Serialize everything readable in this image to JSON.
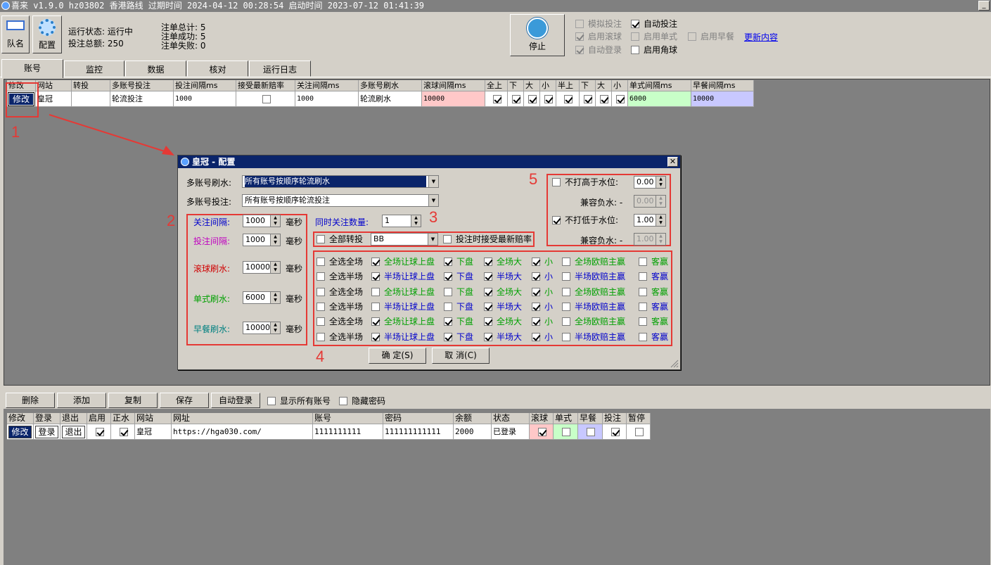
{
  "window": {
    "title": "喜来 v1.9.0 hz03802 香港路线 过期时间 2024-04-12 00:28:54 启动时间 2023-07-12 01:41:39",
    "min_label": "_"
  },
  "top": {
    "btn_team": "队名",
    "btn_config": "配置",
    "status_label": "运行状态: 运行中",
    "total_label": "投注总额: 250",
    "orders_total": "注单总计: 5",
    "orders_ok": "注单成功: 5",
    "orders_fail": "注单失败: 0",
    "stop_label": "停止",
    "options": [
      {
        "label": "模拟投注",
        "checked": false,
        "disabled": true
      },
      {
        "label": "自动投注",
        "checked": true,
        "disabled": false
      },
      {
        "label": "启用滚球",
        "checked": true,
        "disabled": true
      },
      {
        "label": "启用单式",
        "checked": false,
        "disabled": true
      },
      {
        "label": "启用早餐",
        "checked": false,
        "disabled": true
      },
      {
        "label": "自动登录",
        "checked": true,
        "disabled": true
      },
      {
        "label": "启用角球",
        "checked": false,
        "disabled": false
      }
    ],
    "update_link": "更新内容"
  },
  "tabs": [
    "账号",
    "监控",
    "数据",
    "核对",
    "运行日志"
  ],
  "grid1": {
    "headers": [
      "修改",
      "网站",
      "转投",
      "多账号投注",
      "投注间隔ms",
      "接受最新赔率",
      "关注间隔ms",
      "多账号刷水",
      "滚球间隔ms",
      "全上",
      "下",
      "大",
      "小",
      "半上",
      "下",
      "大",
      "小",
      "单式间隔ms",
      "早餐间隔ms"
    ],
    "row": {
      "edit": "修改",
      "site": "皇冠",
      "transfer": "",
      "multi_bet": "轮流投注",
      "bet_interval": "1000",
      "watch_interval": "1000",
      "multi_refresh": "轮流刷水",
      "live_interval": "10000",
      "single_interval": "6000",
      "early_interval": "10000"
    },
    "row_checks": [
      true,
      true,
      true,
      true,
      true,
      true,
      true,
      true
    ]
  },
  "annotations": [
    "1",
    "2",
    "3",
    "4",
    "5"
  ],
  "dialog": {
    "title": "皇冠 - 配置",
    "multi_refresh_label": "多账号刷水:",
    "multi_refresh_value": "所有账号按顺序轮流刷水",
    "multi_bet_label": "多账号投注:",
    "multi_bet_value": "所有账号按顺序轮流投注",
    "intervals": [
      {
        "label": "关注间隔:",
        "value": "1000",
        "unit": "毫秒",
        "color": "#0000cc"
      },
      {
        "label": "投注间隔:",
        "value": "1000",
        "unit": "毫秒",
        "color": "#c000c0"
      },
      {
        "label": "滚球刷水:",
        "value": "10000",
        "unit": "毫秒",
        "color": "#d00000"
      },
      {
        "label": "单式刷水:",
        "value": "6000",
        "unit": "毫秒",
        "color": "#00a000"
      },
      {
        "label": "早餐刷水:",
        "value": "10000",
        "unit": "毫秒",
        "color": "#008080"
      }
    ],
    "concurrent_label": "同时关注数量:",
    "concurrent_value": "1",
    "transfer_all_label": "全部转投",
    "transfer_value": "BB",
    "accept_odds_label": "投注时接受最新赔率",
    "water": [
      {
        "label": "不打高于水位:",
        "value": "0.00",
        "checked": false
      },
      {
        "label": "兼容负水: -",
        "value": "0.00"
      },
      {
        "label": "不打低于水位:",
        "value": "1.00",
        "checked": true
      },
      {
        "label": "兼容负水: -",
        "value": "1.00"
      }
    ],
    "matrix": [
      [
        {
          "t": "全选全场",
          "c": false,
          "k": "#000"
        },
        {
          "t": "全场让球上盘",
          "c": true,
          "k": "#00a000"
        },
        {
          "t": "下盘",
          "c": true,
          "k": "#00a000"
        },
        {
          "t": "全场大",
          "c": true,
          "k": "#00a000"
        },
        {
          "t": "小",
          "c": true,
          "k": "#00a000"
        },
        {
          "t": "全场欧赔主赢",
          "c": false,
          "k": "#00a000"
        },
        {
          "t": "客赢",
          "c": false,
          "k": "#00a000"
        }
      ],
      [
        {
          "t": "全选半场",
          "c": false,
          "k": "#000"
        },
        {
          "t": "半场让球上盘",
          "c": true,
          "k": "#0000cc"
        },
        {
          "t": "下盘",
          "c": true,
          "k": "#0000cc"
        },
        {
          "t": "半场大",
          "c": true,
          "k": "#0000cc"
        },
        {
          "t": "小",
          "c": true,
          "k": "#0000cc"
        },
        {
          "t": "半场欧赔主赢",
          "c": false,
          "k": "#0000cc"
        },
        {
          "t": "客赢",
          "c": false,
          "k": "#0000cc"
        }
      ],
      [
        {
          "t": "全选全场",
          "c": false,
          "k": "#000"
        },
        {
          "t": "全场让球上盘",
          "c": false,
          "k": "#00a000"
        },
        {
          "t": "下盘",
          "c": false,
          "k": "#00a000"
        },
        {
          "t": "全场大",
          "c": true,
          "k": "#00a000"
        },
        {
          "t": "小",
          "c": true,
          "k": "#00a000"
        },
        {
          "t": "全场欧赔主赢",
          "c": false,
          "k": "#00a000"
        },
        {
          "t": "客赢",
          "c": false,
          "k": "#00a000"
        }
      ],
      [
        {
          "t": "全选半场",
          "c": false,
          "k": "#000"
        },
        {
          "t": "半场让球上盘",
          "c": false,
          "k": "#0000cc"
        },
        {
          "t": "下盘",
          "c": false,
          "k": "#0000cc"
        },
        {
          "t": "半场大",
          "c": true,
          "k": "#0000cc"
        },
        {
          "t": "小",
          "c": true,
          "k": "#0000cc"
        },
        {
          "t": "半场欧赔主赢",
          "c": false,
          "k": "#0000cc"
        },
        {
          "t": "客赢",
          "c": false,
          "k": "#0000cc"
        }
      ],
      [
        {
          "t": "全选全场",
          "c": false,
          "k": "#000"
        },
        {
          "t": "全场让球上盘",
          "c": true,
          "k": "#00a000"
        },
        {
          "t": "下盘",
          "c": true,
          "k": "#00a000"
        },
        {
          "t": "全场大",
          "c": true,
          "k": "#00a000"
        },
        {
          "t": "小",
          "c": true,
          "k": "#00a000"
        },
        {
          "t": "全场欧赔主赢",
          "c": false,
          "k": "#00a000"
        },
        {
          "t": "客赢",
          "c": false,
          "k": "#00a000"
        }
      ],
      [
        {
          "t": "全选半场",
          "c": false,
          "k": "#000"
        },
        {
          "t": "半场让球上盘",
          "c": true,
          "k": "#0000cc"
        },
        {
          "t": "下盘",
          "c": true,
          "k": "#0000cc"
        },
        {
          "t": "半场大",
          "c": true,
          "k": "#0000cc"
        },
        {
          "t": "小",
          "c": true,
          "k": "#0000cc"
        },
        {
          "t": "半场欧赔主赢",
          "c": false,
          "k": "#0000cc"
        },
        {
          "t": "客赢",
          "c": false,
          "k": "#0000cc"
        }
      ]
    ],
    "ok_label": "确 定(S)",
    "cancel_label": "取 消(C)"
  },
  "toolbar2": {
    "delete": "删除",
    "add": "添加",
    "copy": "复制",
    "save": "保存",
    "auto_login": "自动登录",
    "show_all": "显示所有账号",
    "hide_pwd": "隐藏密码"
  },
  "grid2": {
    "headers": [
      "修改",
      "登录",
      "退出",
      "启用",
      "正水",
      "网站",
      "网址",
      "账号",
      "密码",
      "余额",
      "状态",
      "滚球",
      "单式",
      "早餐",
      "投注",
      "暂停"
    ],
    "row": {
      "edit": "修改",
      "login": "登录",
      "logout": "退出",
      "site": "皇冠",
      "url": "https://hga030.com/",
      "account": "1111111111",
      "password": "111111111111",
      "balance": "2000",
      "status": "已登录"
    },
    "checks": {
      "enable": true,
      "positive": true,
      "live": true,
      "single": false,
      "early": false,
      "bet": true,
      "pause": false
    }
  },
  "colors": {
    "titlebar": "#808080",
    "dialog_title": "#0a246a",
    "pink": "#ffc8c8",
    "green": "#c8ffc8",
    "lavender": "#c8c8ff",
    "annotation": "#e53935"
  }
}
